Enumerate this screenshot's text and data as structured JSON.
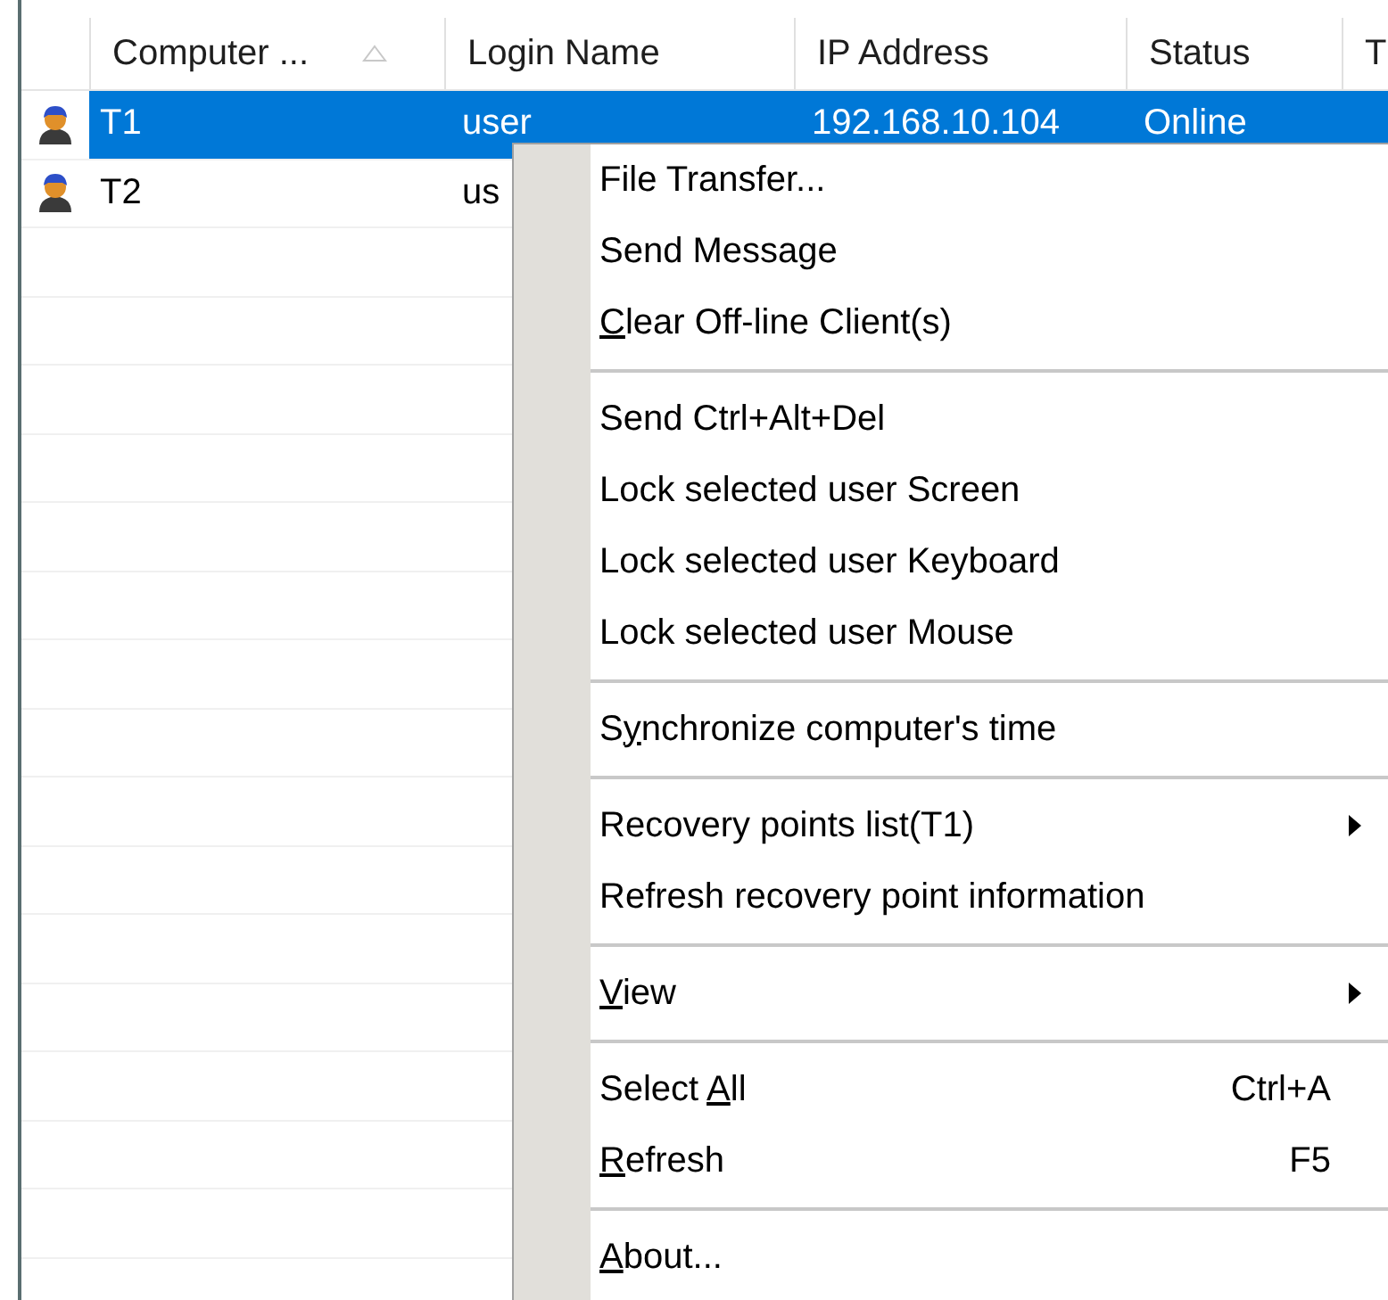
{
  "list": {
    "columns": [
      {
        "label": "Computer ...",
        "sorted": true
      },
      {
        "label": "Login Name",
        "sorted": false
      },
      {
        "label": "IP Address",
        "sorted": false
      },
      {
        "label": "Status",
        "sorted": false
      },
      {
        "label": "T",
        "sorted": false
      }
    ],
    "rows": [
      {
        "selected": true,
        "cells": [
          "T1",
          "user",
          "192.168.10.104",
          "Online"
        ]
      },
      {
        "selected": false,
        "cells": [
          "T2",
          "us"
        ]
      }
    ]
  },
  "context_menu": {
    "items": [
      {
        "kind": "item",
        "before": "File Transfer...",
        "submenu": false
      },
      {
        "kind": "item",
        "before": "Send Message",
        "submenu": false
      },
      {
        "kind": "item",
        "mnemonic": "C",
        "after": "lear Off-line Client(s)",
        "submenu": false
      },
      {
        "kind": "separator"
      },
      {
        "kind": "item",
        "before": "Send Ctrl+Alt+Del",
        "submenu": false
      },
      {
        "kind": "item",
        "before": "Lock selected user Screen",
        "submenu": false
      },
      {
        "kind": "item",
        "before": "Lock selected user Keyboard",
        "submenu": false
      },
      {
        "kind": "item",
        "before": "Lock selected user Mouse",
        "submenu": false
      },
      {
        "kind": "separator"
      },
      {
        "kind": "item",
        "before": "S",
        "mnemonic": "y",
        "after": "nchronize computer's time",
        "submenu": false
      },
      {
        "kind": "separator"
      },
      {
        "kind": "item",
        "before": "Recovery points list(T1)",
        "submenu": true
      },
      {
        "kind": "item",
        "before": "Refresh recovery point information",
        "submenu": false
      },
      {
        "kind": "separator"
      },
      {
        "kind": "item",
        "mnemonic": "V",
        "after": "iew",
        "submenu": true
      },
      {
        "kind": "separator"
      },
      {
        "kind": "item",
        "before": "Select ",
        "mnemonic": "A",
        "after": "ll",
        "shortcut": "Ctrl+A",
        "submenu": false
      },
      {
        "kind": "item",
        "mnemonic": "R",
        "after": "efresh",
        "shortcut": "F5",
        "submenu": false
      },
      {
        "kind": "separator"
      },
      {
        "kind": "item",
        "mnemonic": "A",
        "after": "bout...",
        "submenu": false
      }
    ]
  }
}
